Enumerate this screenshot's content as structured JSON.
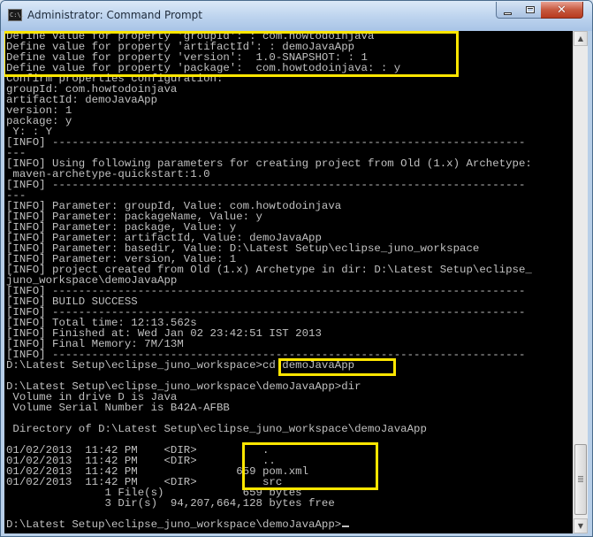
{
  "window": {
    "title": "Administrator: Command Prompt",
    "icon": "cmd-app-icon",
    "icon_text": "C:\\.",
    "controls": {
      "minimize": "minimize-icon",
      "maximize": "maximize-icon",
      "close_glyph": "✕"
    }
  },
  "console": {
    "text_color": "#c0c0c0",
    "background": "#000000",
    "highlight_color": "#ffe600",
    "lines": [
      "Define value for property 'groupId': : com.howtodoinjava",
      "Define value for property 'artifactId': : demoJavaApp",
      "Define value for property 'version':  1.0-SNAPSHOT: : 1",
      "Define value for property 'package':  com.howtodoinjava: : y",
      "Confirm properties configuration:",
      "groupId: com.howtodoinjava",
      "artifactId: demoJavaApp",
      "version: 1",
      "package: y",
      " Y: : Y",
      "[INFO] ------------------------------------------------------------------------",
      "---",
      "[INFO] Using following parameters for creating project from Old (1.x) Archetype:",
      " maven-archetype-quickstart:1.0",
      "[INFO] ------------------------------------------------------------------------",
      "---",
      "[INFO] Parameter: groupId, Value: com.howtodoinjava",
      "[INFO] Parameter: packageName, Value: y",
      "[INFO] Parameter: package, Value: y",
      "[INFO] Parameter: artifactId, Value: demoJavaApp",
      "[INFO] Parameter: basedir, Value: D:\\Latest Setup\\eclipse_juno_workspace",
      "[INFO] Parameter: version, Value: 1",
      "[INFO] project created from Old (1.x) Archetype in dir: D:\\Latest Setup\\eclipse_",
      "juno_workspace\\demoJavaApp",
      "[INFO] ------------------------------------------------------------------------",
      "[INFO] BUILD SUCCESS",
      "[INFO] ------------------------------------------------------------------------",
      "[INFO] Total time: 12:13.562s",
      "[INFO] Finished at: Wed Jan 02 23:42:51 IST 2013",
      "[INFO] Final Memory: 7M/13M",
      "[INFO] ------------------------------------------------------------------------",
      "D:\\Latest Setup\\eclipse_juno_workspace>cd demoJavaApp",
      "",
      "D:\\Latest Setup\\eclipse_juno_workspace\\demoJavaApp>dir",
      " Volume in drive D is Java",
      " Volume Serial Number is B42A-AFBB",
      "",
      " Directory of D:\\Latest Setup\\eclipse_juno_workspace\\demoJavaApp",
      "",
      "01/02/2013  11:42 PM    <DIR>          .",
      "01/02/2013  11:42 PM    <DIR>          ..",
      "01/02/2013  11:42 PM               659 pom.xml",
      "01/02/2013  11:42 PM    <DIR>          src",
      "               1 File(s)            659 bytes",
      "               3 Dir(s)  94,207,664,128 bytes free",
      "",
      "D:\\Latest Setup\\eclipse_juno_workspace\\demoJavaApp>"
    ]
  },
  "scrollbar": {
    "up_arrow": "▲",
    "down_arrow": "▼"
  }
}
